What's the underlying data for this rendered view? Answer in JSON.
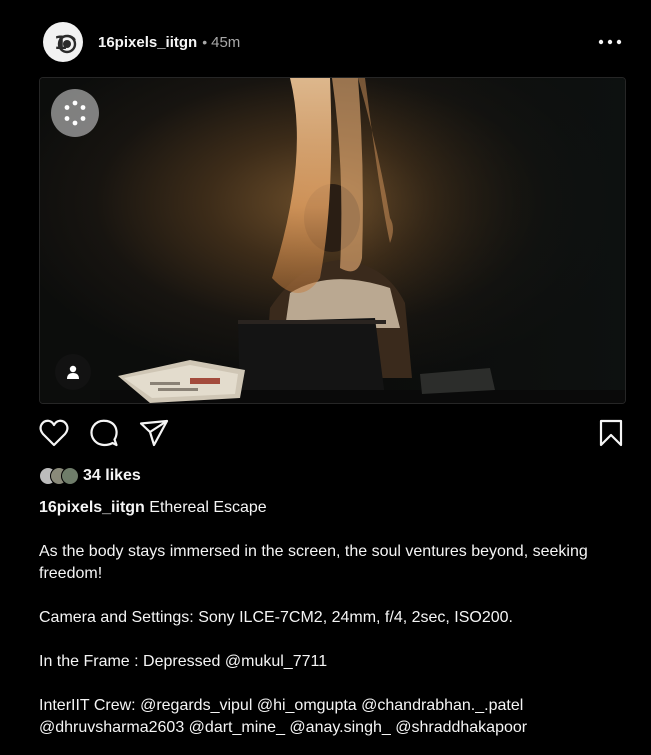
{
  "post": {
    "username": "16pixels_iitgn",
    "separator": "•",
    "time": "45m",
    "avatar_icon": "camera-aperture-logo",
    "more_icon": "more-horizontal-icon"
  },
  "media": {
    "loading_icon": "loading-spinner-icon",
    "tag_icon": "user-tag-icon"
  },
  "actions": {
    "like_icon": "heart-icon",
    "comment_icon": "comment-icon",
    "share_icon": "share-icon",
    "save_icon": "bookmark-icon"
  },
  "likes": {
    "count_text": "34 likes",
    "avatar_colors": [
      "#bcbcbc",
      "#8a8a7a",
      "#6f7d6a"
    ]
  },
  "caption": {
    "username": "16pixels_iitgn",
    "title": "Ethereal Escape",
    "line1": "As the body stays immersed in the screen, the soul ventures beyond, seeking freedom!",
    "line2": "Camera and Settings: Sony ILCE-7CM2, 24mm, f/4, 2sec, ISO200.",
    "line3_prefix": "In the Frame : Depressed",
    "line3_mention": "@mukul_7711",
    "line4_prefix": "InterIIT Crew:",
    "crew_mentions": [
      "@regards_vipul",
      "@hi_omgupta",
      "@chandrabhan._.patel",
      "@dhruvsharma2603",
      "@dart_mine_",
      "@anay.singh_",
      "@shraddhakapoor"
    ]
  },
  "colors": {
    "background": "#000000",
    "text": "#f5f5f5",
    "secondary_text": "#a8a8a8"
  }
}
